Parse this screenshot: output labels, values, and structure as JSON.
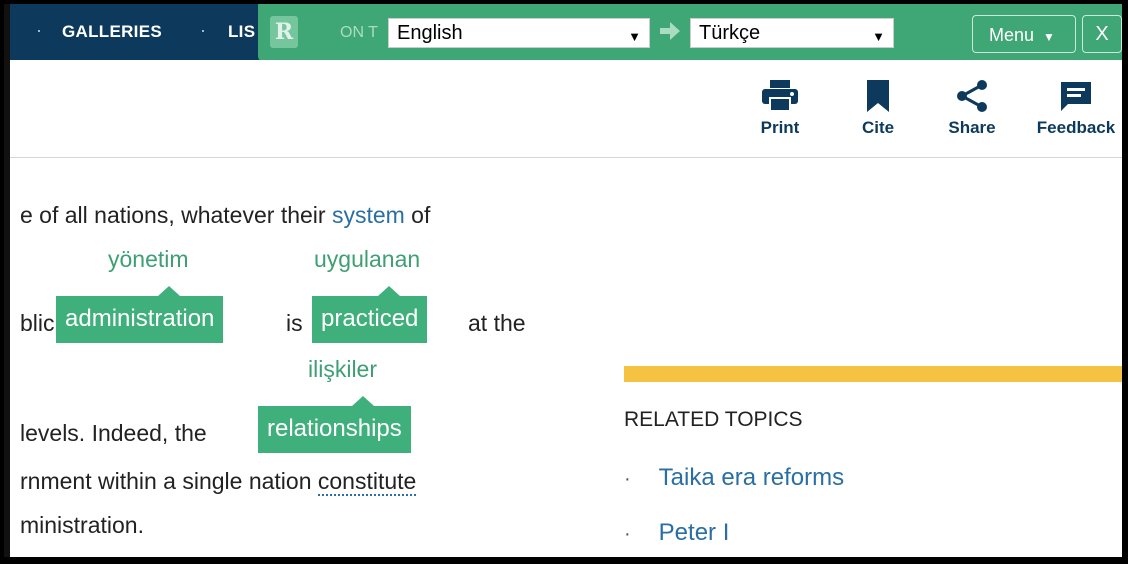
{
  "nav": {
    "items": [
      "GALLERIES",
      "LIS"
    ],
    "ghost_text": "ON T"
  },
  "translator": {
    "logo_letter": "R",
    "source_language": "English",
    "target_language": "Türkçe",
    "menu_label": "Menu",
    "close_label": "X",
    "accent_color": "#3fa676"
  },
  "toolbar": {
    "print_label": "Print",
    "cite_label": "Cite",
    "share_label": "Share",
    "feedback_label": "Feedback"
  },
  "article": {
    "line1_text": "e of all nations, whatever their ",
    "line1_link": "system",
    "line1_tail": " of",
    "line2_prefix": "blic",
    "line2_mid": "is",
    "line2_tail": "at the",
    "line3_prefix": "levels. Indeed, the",
    "line4_text": "rnment within a single nation ",
    "line4_link": "constitute",
    "line5_text": "ministration.",
    "highlights": [
      {
        "word": "administration",
        "translation": "yönetim"
      },
      {
        "word": "practiced",
        "translation": "uygulanan"
      },
      {
        "word": "relationships",
        "translation": "ilişkiler"
      }
    ]
  },
  "sidebar": {
    "related_title": "RELATED TOPICS",
    "related_items": [
      "Taika era reforms",
      "Peter I"
    ]
  }
}
